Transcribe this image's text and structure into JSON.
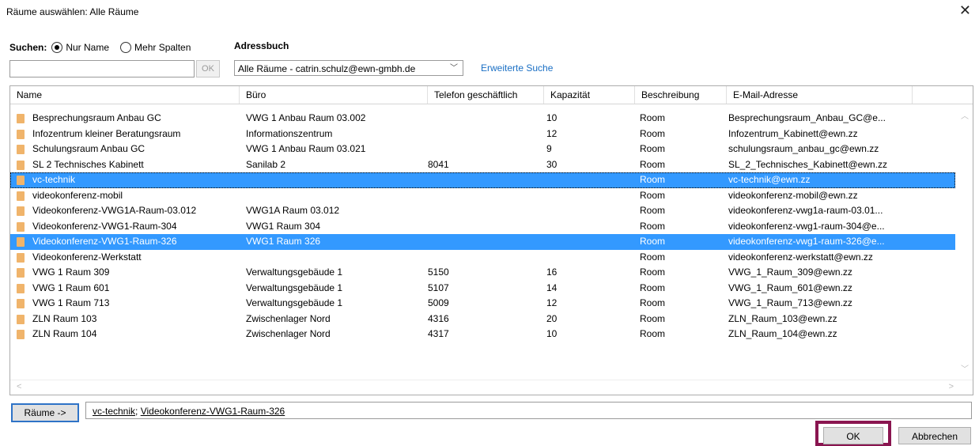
{
  "window": {
    "title": "Räume auswählen: Alle Räume",
    "close_glyph": "✕"
  },
  "search": {
    "label": "Suchen:",
    "radio_name": "Nur Name",
    "radio_more": "Mehr Spalten",
    "selected": "Nur Name",
    "input_value": "",
    "ok_label": "OK"
  },
  "addressbook": {
    "label": "Adressbuch",
    "selected": "Alle Räume - catrin.schulz@ewn-gmbh.de",
    "advanced_search": "Erweiterte Suche"
  },
  "columns": [
    "Name",
    "Büro",
    "Telefon geschäftlich",
    "Kapazität",
    "Beschreibung",
    "E-Mail-Adresse"
  ],
  "rows": [
    {
      "name": "Besprechungsraum Anbau GC",
      "office": "VWG 1 Anbau Raum 03.002",
      "phone": "",
      "capacity": "10",
      "desc": "Room",
      "email": "Besprechungsraum_Anbau_GC@e...",
      "selected": false
    },
    {
      "name": "Infozentrum kleiner Beratungsraum",
      "office": "Informationszentrum",
      "phone": "",
      "capacity": "12",
      "desc": "Room",
      "email": "Infozentrum_Kabinett@ewn.zz",
      "selected": false
    },
    {
      "name": "Schulungsraum Anbau GC",
      "office": "VWG 1 Anbau Raum 03.021",
      "phone": "",
      "capacity": "9",
      "desc": "Room",
      "email": "schulungsraum_anbau_gc@ewn.zz",
      "selected": false
    },
    {
      "name": "SL 2 Technisches Kabinett",
      "office": "Sanilab 2",
      "phone": "8041",
      "capacity": "30",
      "desc": "Room",
      "email": "SL_2_Technisches_Kabinett@ewn.zz",
      "selected": false
    },
    {
      "name": "vc-technik",
      "office": "",
      "phone": "",
      "capacity": "",
      "desc": "Room",
      "email": "vc-technik@ewn.zz",
      "selected": true
    },
    {
      "name": "videokonferenz-mobil",
      "office": "",
      "phone": "",
      "capacity": "",
      "desc": "Room",
      "email": "videokonferenz-mobil@ewn.zz",
      "selected": false
    },
    {
      "name": "Videokonferenz-VWG1A-Raum-03.012",
      "office": "VWG1A Raum 03.012",
      "phone": "",
      "capacity": "",
      "desc": "Room",
      "email": "videokonferenz-vwg1a-raum-03.01...",
      "selected": false
    },
    {
      "name": "Videokonferenz-VWG1-Raum-304",
      "office": "VWG1 Raum 304",
      "phone": "",
      "capacity": "",
      "desc": "Room",
      "email": "videokonferenz-vwg1-raum-304@e...",
      "selected": false
    },
    {
      "name": "Videokonferenz-VWG1-Raum-326",
      "office": "VWG1 Raum 326",
      "phone": "",
      "capacity": "",
      "desc": "Room",
      "email": "videokonferenz-vwg1-raum-326@e...",
      "selected": true
    },
    {
      "name": "Videokonferenz-Werkstatt",
      "office": "",
      "phone": "",
      "capacity": "",
      "desc": "Room",
      "email": "videokonferenz-werkstatt@ewn.zz",
      "selected": false
    },
    {
      "name": "VWG 1 Raum 309",
      "office": "Verwaltungsgebäude 1",
      "phone": "5150",
      "capacity": "16",
      "desc": "Room",
      "email": "VWG_1_Raum_309@ewn.zz",
      "selected": false
    },
    {
      "name": "VWG 1 Raum 601",
      "office": "Verwaltungsgebäude 1",
      "phone": "5107",
      "capacity": "14",
      "desc": "Room",
      "email": "VWG_1_Raum_601@ewn.zz",
      "selected": false
    },
    {
      "name": "VWG 1 Raum 713",
      "office": "Verwaltungsgebäude 1",
      "phone": "5009",
      "capacity": "12",
      "desc": "Room",
      "email": "VWG_1_Raum_713@ewn.zz",
      "selected": false
    },
    {
      "name": "ZLN Raum 103",
      "office": "Zwischenlager Nord",
      "phone": "4316",
      "capacity": "20",
      "desc": "Room",
      "email": "ZLN_Raum_103@ewn.zz",
      "selected": false
    },
    {
      "name": "ZLN Raum 104",
      "office": "Zwischenlager Nord",
      "phone": "4317",
      "capacity": "10",
      "desc": "Room",
      "email": "ZLN_Raum_104@ewn.zz",
      "selected": false
    }
  ],
  "rooms_button": "Räume ->",
  "picked": [
    "vc-technik",
    "Videokonferenz-VWG1-Raum-326"
  ],
  "buttons": {
    "ok": "OK",
    "cancel": "Abbrechen"
  },
  "colors": {
    "selection": "#3399ff",
    "link": "#1a6fc4",
    "ok_highlight": "#8a1550",
    "room_icon": "#f0b46b"
  },
  "icons": {
    "room": "room-icon",
    "close": "close-icon"
  }
}
